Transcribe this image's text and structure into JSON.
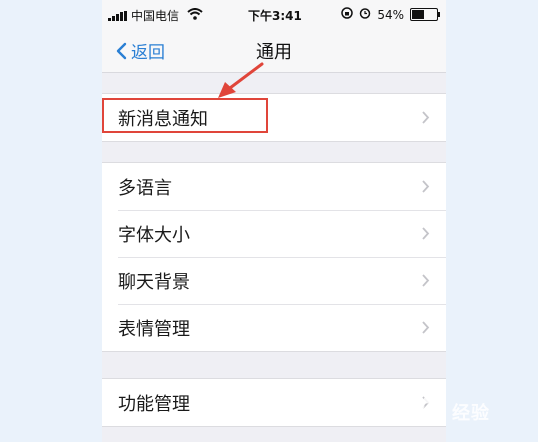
{
  "status_bar": {
    "carrier": "中国电信",
    "time": "下午3:41",
    "battery": "54%",
    "battery_fraction": 0.54,
    "icons": [
      "signal-icon",
      "wifi-icon",
      "rotation-lock-icon",
      "alarm-icon",
      "battery-icon"
    ]
  },
  "nav": {
    "back_label": "返回",
    "title": "通用"
  },
  "groups": [
    {
      "items": [
        {
          "label": "新消息通知",
          "highlighted": true
        }
      ]
    },
    {
      "items": [
        {
          "label": "多语言"
        },
        {
          "label": "字体大小"
        },
        {
          "label": "聊天背景"
        },
        {
          "label": "表情管理"
        }
      ]
    },
    {
      "items": [
        {
          "label": "功能管理"
        }
      ]
    }
  ],
  "colors": {
    "accent": "#2a7fd4",
    "highlight": "#e0453a",
    "background": "#efeff4"
  },
  "watermark": {
    "text": "经验"
  }
}
